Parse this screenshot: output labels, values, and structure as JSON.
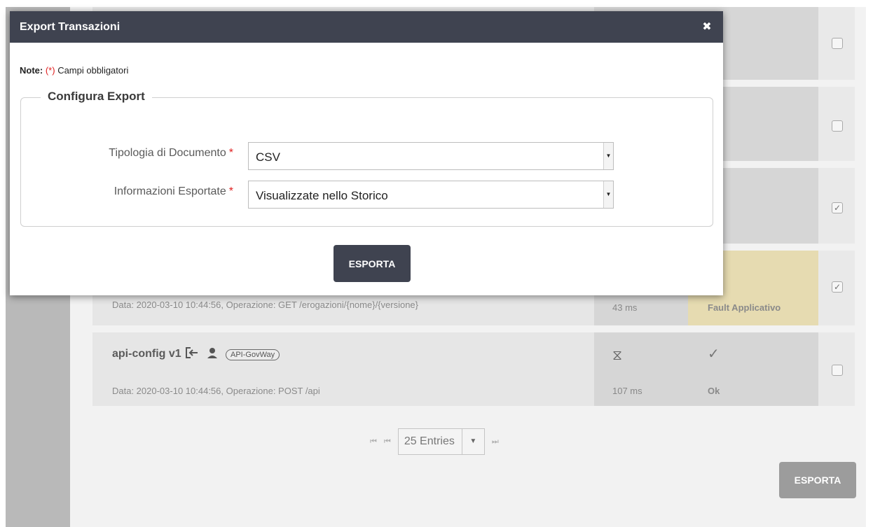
{
  "modal": {
    "title": "Export Transazioni",
    "close_symbol": "✖",
    "note_prefix": "Note:",
    "note_marker": "(*)",
    "note_text": "Campi obbligatori",
    "legend": "Configura Export",
    "fields": [
      {
        "label": "Tipologia di Documento",
        "required_mark": "*",
        "value": "CSV"
      },
      {
        "label": "Informazioni Esportate",
        "required_mark": "*",
        "value": "Visualizzate nello Storico"
      }
    ],
    "export_label": "ESPORTA"
  },
  "rows": [
    {
      "checked": false,
      "check_glyph": ""
    },
    {
      "checked": false,
      "check_glyph": ""
    },
    {
      "checked": true,
      "check_glyph": "✓"
    },
    {
      "checked": true,
      "check_glyph": "✓",
      "subtitle": "Data: 2020-03-10 10:44:56,  Operazione: GET /erogazioni/{nome}/{versione}",
      "latency": "43 ms",
      "status": "Fault Applicativo"
    },
    {
      "checked": false,
      "check_glyph": "",
      "title": "api-config v1",
      "badge": "API-GovWay",
      "subtitle": "Data: 2020-03-10 10:44:56,  Operazione: POST /api",
      "latency": "107 ms",
      "status": "Ok",
      "status_glyph": "✓",
      "meta_glyph": "⧖"
    }
  ],
  "pagination": {
    "first_glyph": "⏮",
    "prev_glyph": "⏮",
    "entries": "25 Entries",
    "next_glyph": "⏭"
  },
  "page_export_label": "ESPORTA",
  "colors": {
    "modal_header": "#3f4350",
    "required": "#e02020",
    "fault_bg": "#e6dbb1"
  }
}
